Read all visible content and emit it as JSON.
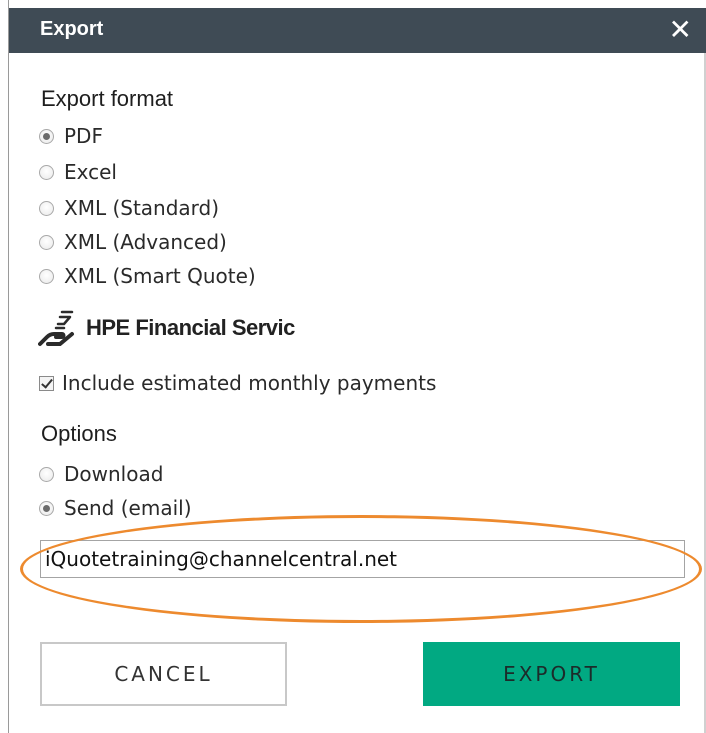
{
  "dialog": {
    "title": "Export",
    "close_symbol": "✕"
  },
  "export_format": {
    "heading": "Export format",
    "options": [
      {
        "label": "PDF",
        "checked": true
      },
      {
        "label": "Excel",
        "checked": false
      },
      {
        "label": "XML (Standard)",
        "checked": false
      },
      {
        "label": "XML (Advanced)",
        "checked": false
      },
      {
        "label": "XML (Smart Quote)",
        "checked": false
      }
    ]
  },
  "financial": {
    "logo_icon": "hand-coin-icon",
    "label": "HPE Financial Servic",
    "include_payments": {
      "label": "Include estimated monthly payments",
      "checked": true
    }
  },
  "options": {
    "heading": "Options",
    "items": [
      {
        "label": "Download",
        "checked": false
      },
      {
        "label": "Send (email)",
        "checked": true
      }
    ],
    "email_value": "iQuotetraining@channelcentral.net"
  },
  "buttons": {
    "cancel": "CANCEL",
    "export": "EXPORT"
  },
  "colors": {
    "titlebar": "#3f4b55",
    "export_button": "#01a982",
    "highlight_ring": "#ed8a2e"
  }
}
